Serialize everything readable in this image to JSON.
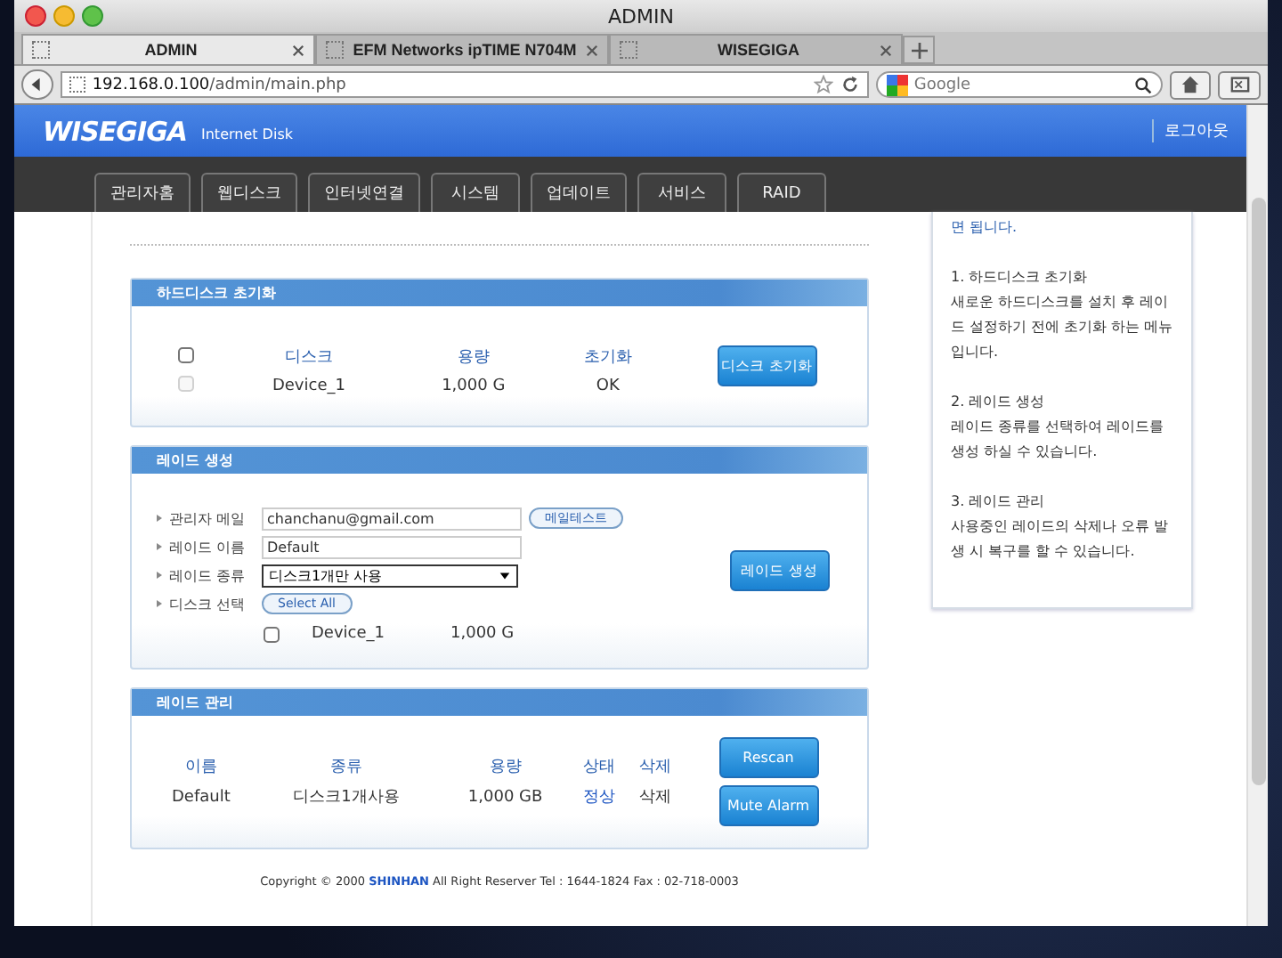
{
  "window": {
    "title": "ADMIN"
  },
  "browser_tabs": [
    {
      "label": "ADMIN",
      "selected": true
    },
    {
      "label": "EFM Networks ipTIME N704M",
      "selected": false
    },
    {
      "label": "WISEGIGA",
      "selected": false
    }
  ],
  "address": {
    "host": "192.168.0.100",
    "path": "/admin/main.php"
  },
  "search": {
    "placeholder": "Google"
  },
  "header": {
    "logo": "WISEGIGA",
    "subtitle": "Internet Disk",
    "logout": "로그아웃"
  },
  "nav": [
    "관리자홈",
    "웹디스크",
    "인터넷연결",
    "시스템",
    "업데이트",
    "서비스",
    "RAID"
  ],
  "disk_init": {
    "title": "하드디스크 초기화",
    "header_checked": false,
    "columns": [
      "디스크",
      "용량",
      "초기화"
    ],
    "rows": [
      {
        "checked": false,
        "disabled": true,
        "cells": [
          "Device_1",
          "1,000 G",
          "OK"
        ]
      }
    ],
    "button": "디스크 초기화"
  },
  "raid_create": {
    "title": "레이드 생성",
    "email": {
      "label": "관리자 메일",
      "value": "chanchanu@gmail.com",
      "button": "메일테스트"
    },
    "name": {
      "label": "레이드 이름",
      "value": "Default"
    },
    "type": {
      "label": "레이드 종류",
      "value": "디스크1개만 사용"
    },
    "disk_select": {
      "label": "디스크 선택",
      "button": "Select All"
    },
    "disks": [
      {
        "checked": false,
        "name": "Device_1",
        "size": "1,000 G"
      }
    ],
    "button": "레이드 생성"
  },
  "raid_manage": {
    "title": "레이드 관리",
    "columns": [
      "이름",
      "종류",
      "용량",
      "상태",
      "삭제"
    ],
    "rows": [
      {
        "cells": [
          {
            "text": "Default",
            "kind": "plain"
          },
          {
            "text": "디스크1개사용",
            "kind": "plain"
          },
          {
            "text": "1,000 GB",
            "kind": "plain"
          },
          {
            "text": "정상",
            "kind": "status"
          },
          {
            "text": "삭제",
            "kind": "plain"
          }
        ]
      }
    ],
    "buttons": [
      "Rescan",
      "Mute Alarm"
    ]
  },
  "footer": "Copyright © 2000 **SHINHAN** All Right Reserver Tel : 1644-1824 Fax : 02-718-0003",
  "help": [
    {
      "title": "면 됩니다.",
      "kind": "lead"
    },
    {
      "title": "1. 하드디스크 초기화",
      "body": "새로운 하드디스크를 설치 후 레이드 설정하기 전에 초기화 하는 메뉴입니다.",
      "kind": "item"
    },
    {
      "title": "2. 레이드 생성",
      "body": "레이드 종류를 선택하여 레이드를 생성 하실 수 있습니다.",
      "kind": "item"
    },
    {
      "title": "3. 레이드 관리",
      "body": "사용중인 레이드의 삭제나 오류 발생 시 복구를 할 수 있습니다.",
      "kind": "item"
    }
  ]
}
